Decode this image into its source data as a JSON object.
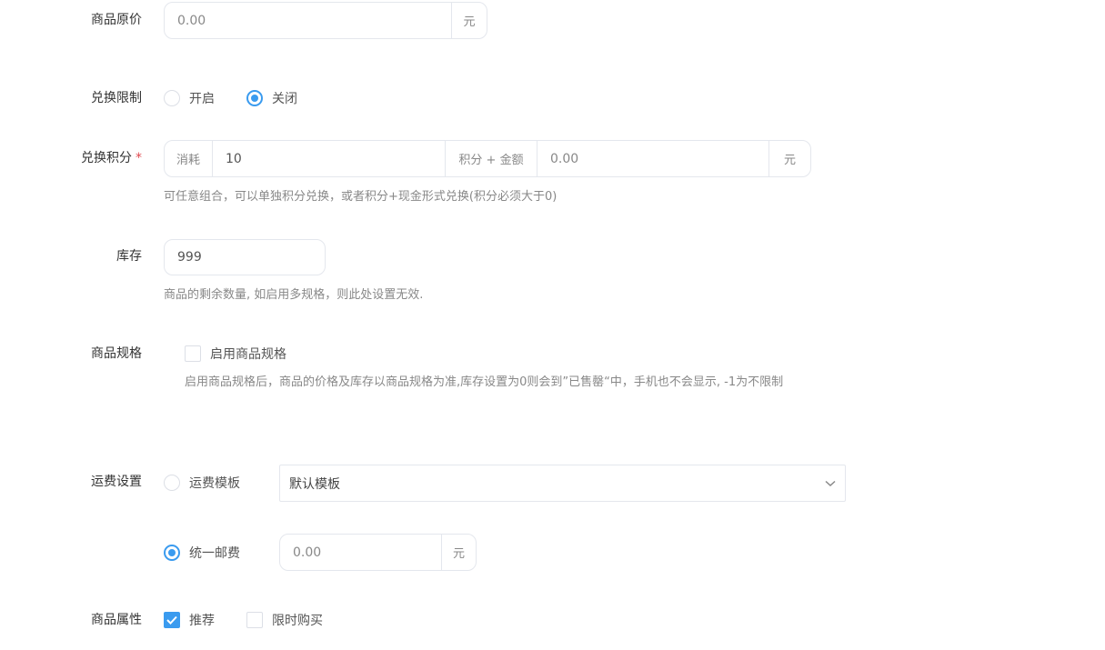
{
  "original_price": {
    "label": "商品原价",
    "placeholder": "0.00",
    "unit": "元"
  },
  "exchange_limit": {
    "label": "兑换限制",
    "options": [
      {
        "label": "开启",
        "checked": false
      },
      {
        "label": "关闭",
        "checked": true
      }
    ]
  },
  "exchange_points": {
    "label": "兑换积分",
    "required_mark": "*",
    "prefix": "消耗",
    "points_value": "10",
    "middle": "积分 + 金额",
    "amount_placeholder": "0.00",
    "unit": "元",
    "hint": "可任意组合，可以单独积分兑换，或者积分+现金形式兑换(积分必须大于0)"
  },
  "stock": {
    "label": "库存",
    "value": "999",
    "hint": "商品的剩余数量, 如启用多规格，则此处设置无效."
  },
  "spec": {
    "label": "商品规格",
    "checkbox_label": "启用商品规格",
    "checked": false,
    "hint": "启用商品规格后，商品的价格及库存以商品规格为准,库存设置为0则会到”已售罄“中，手机也不会显示, -1为不限制"
  },
  "shipping": {
    "label": "运费设置",
    "template_option": {
      "label": "运费模板",
      "checked": false
    },
    "template_select": {
      "selected": "默认模板"
    },
    "flat_option": {
      "label": "统一邮费",
      "checked": true
    },
    "flat_placeholder": "0.00",
    "unit": "元"
  },
  "attributes": {
    "label": "商品属性",
    "options": [
      {
        "label": "推荐",
        "checked": true
      },
      {
        "label": "限时购买",
        "checked": false
      }
    ]
  },
  "colors": {
    "accent": "#3a9bef",
    "required": "#e0484f",
    "border": "#e4e7ed"
  }
}
